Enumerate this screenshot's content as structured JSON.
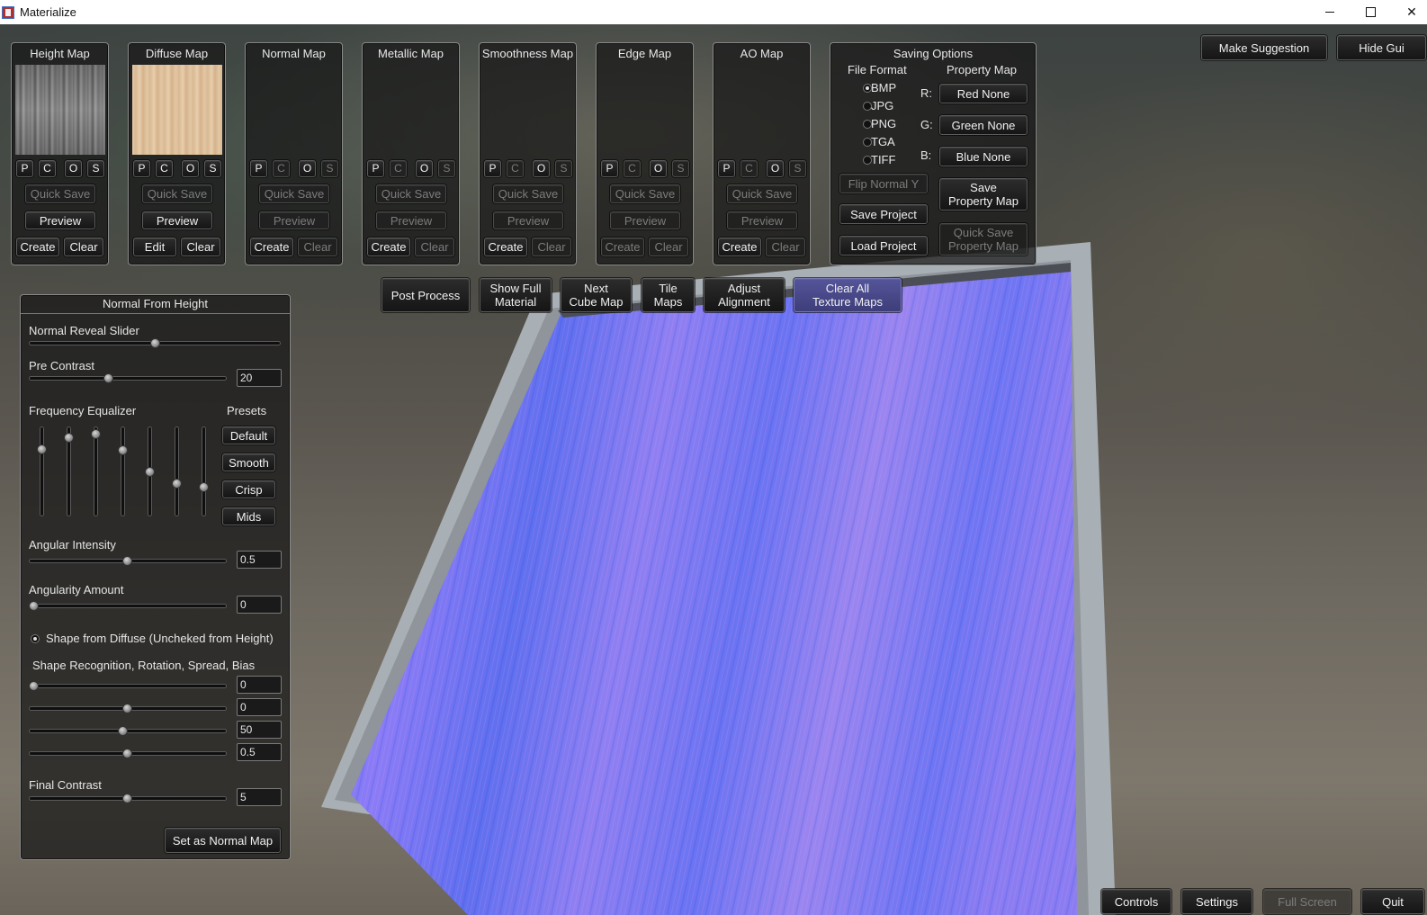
{
  "window": {
    "title": "Materialize"
  },
  "maps": [
    {
      "name": "Height Map",
      "actions": {
        "p": "P",
        "c": "C",
        "o": "O",
        "s": "S"
      },
      "quick_save": "Quick Save",
      "preview": "Preview",
      "create": "Create",
      "clear": "Clear"
    },
    {
      "name": "Diffuse Map",
      "actions": {
        "p": "P",
        "c": "C",
        "o": "O",
        "s": "S"
      },
      "quick_save": "Quick Save",
      "preview": "Preview",
      "create": "Edit",
      "clear": "Clear"
    },
    {
      "name": "Normal Map",
      "actions": {
        "p": "P",
        "c": "C",
        "o": "O",
        "s": "S"
      },
      "quick_save": "Quick Save",
      "preview": "Preview",
      "create": "Create",
      "clear": "Clear"
    },
    {
      "name": "Metallic Map",
      "actions": {
        "p": "P",
        "c": "C",
        "o": "O",
        "s": "S"
      },
      "quick_save": "Quick Save",
      "preview": "Preview",
      "create": "Create",
      "clear": "Clear"
    },
    {
      "name": "Smoothness Map",
      "actions": {
        "p": "P",
        "c": "C",
        "o": "O",
        "s": "S"
      },
      "quick_save": "Quick Save",
      "preview": "Preview",
      "create": "Create",
      "clear": "Clear"
    },
    {
      "name": "Edge Map",
      "actions": {
        "p": "P",
        "c": "C",
        "o": "O",
        "s": "S"
      },
      "quick_save": "Quick Save",
      "preview": "Preview",
      "create": "Create",
      "clear": "Clear"
    },
    {
      "name": "AO Map",
      "actions": {
        "p": "P",
        "c": "C",
        "o": "O",
        "s": "S"
      },
      "quick_save": "Quick Save",
      "preview": "Preview",
      "create": "Create",
      "clear": "Clear"
    }
  ],
  "saving": {
    "title": "Saving Options",
    "file_format_label": "File Format",
    "formats": [
      "BMP",
      "JPG",
      "PNG",
      "TGA",
      "TIFF"
    ],
    "selected_format": "BMP",
    "property_map_label": "Property Map",
    "channels": {
      "r": "R:",
      "g": "G:",
      "b": "B:"
    },
    "red": "Red None",
    "green": "Green None",
    "blue": "Blue None",
    "flip_normal": "Flip Normal Y",
    "save_project": "Save Project",
    "load_project": "Load Project",
    "save_property_map_1": "Save",
    "save_property_map_2": "Property Map",
    "quick_save_property_1": "Quick Save",
    "quick_save_property_2": "Property Map"
  },
  "top_right": {
    "suggest": "Make Suggestion",
    "hide_gui": "Hide Gui"
  },
  "toolbar": {
    "post_process": "Post Process",
    "show_full_1": "Show Full",
    "show_full_2": "Material",
    "next_cube_1": "Next",
    "next_cube_2": "Cube Map",
    "tile_1": "Tile",
    "tile_2": "Maps",
    "adjust_1": "Adjust",
    "adjust_2": "Alignment",
    "clear_all_1": "Clear All",
    "clear_all_2": "Texture Maps"
  },
  "nfh": {
    "title": "Normal From Height",
    "reveal_label": "Normal Reveal Slider",
    "reveal_value": 0.5,
    "pre_contrast_label": "Pre Contrast",
    "pre_contrast": "20",
    "freq_label": "Frequency Equalizer",
    "presets_label": "Presets",
    "eq_levels": [
      0.78,
      0.92,
      0.97,
      0.76,
      0.5,
      0.35,
      0.3
    ],
    "presets": [
      "Default",
      "Smooth",
      "Crisp",
      "Mids"
    ],
    "angular_intensity_label": "Angular Intensity",
    "angular_intensity": "0.5",
    "angularity_label": "Angularity Amount",
    "angularity": "0",
    "shape_diffuse_label": "Shape from Diffuse (Uncheked from Height)",
    "shape_rec_label": "Shape Recognition, Rotation, Spread, Bias",
    "shape_values": [
      "0",
      "0",
      "50",
      "0.5"
    ],
    "final_contrast_label": "Final Contrast",
    "final_contrast": "5",
    "set_normal": "Set as Normal Map"
  },
  "bottom": {
    "controls": "Controls",
    "settings": "Settings",
    "fullscreen": "Full Screen",
    "quit": "Quit"
  },
  "colors": {
    "normal_base": "#7f7fff",
    "normal_pink": "#b07de8",
    "normal_blue": "#5c6cf0",
    "frame": "#a9b0b6"
  }
}
